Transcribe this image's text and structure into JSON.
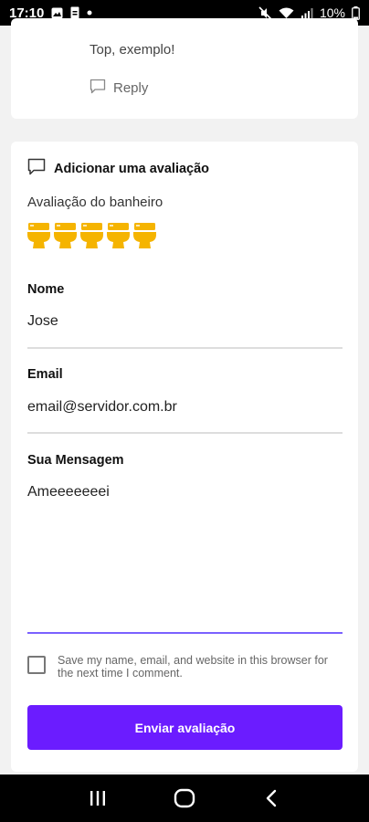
{
  "status_bar": {
    "time": "17:10",
    "battery": "10%"
  },
  "comment": {
    "text": "Top, exemplo!",
    "reply_label": "Reply"
  },
  "form": {
    "title": "Adicionar uma avaliação",
    "rating_label": "Avaliação do banheiro",
    "rating_value": 5,
    "rating_max": 5,
    "rating_color": "#f5b400",
    "name_label": "Nome",
    "name_value": "Jose",
    "email_label": "Email",
    "email_value": "email@servidor.com.br",
    "message_label": "Sua Mensagem",
    "message_value": "Ameeeeeeei",
    "save_info_label": "Save my name, email, and website in this browser for the next time I comment.",
    "submit_label": "Enviar avaliação"
  },
  "colors": {
    "accent": "#6b1cff",
    "focus_line": "#7b61ff"
  },
  "nav_bar": {
    "icons": [
      "recent-apps-icon",
      "home-icon",
      "back-icon"
    ]
  }
}
